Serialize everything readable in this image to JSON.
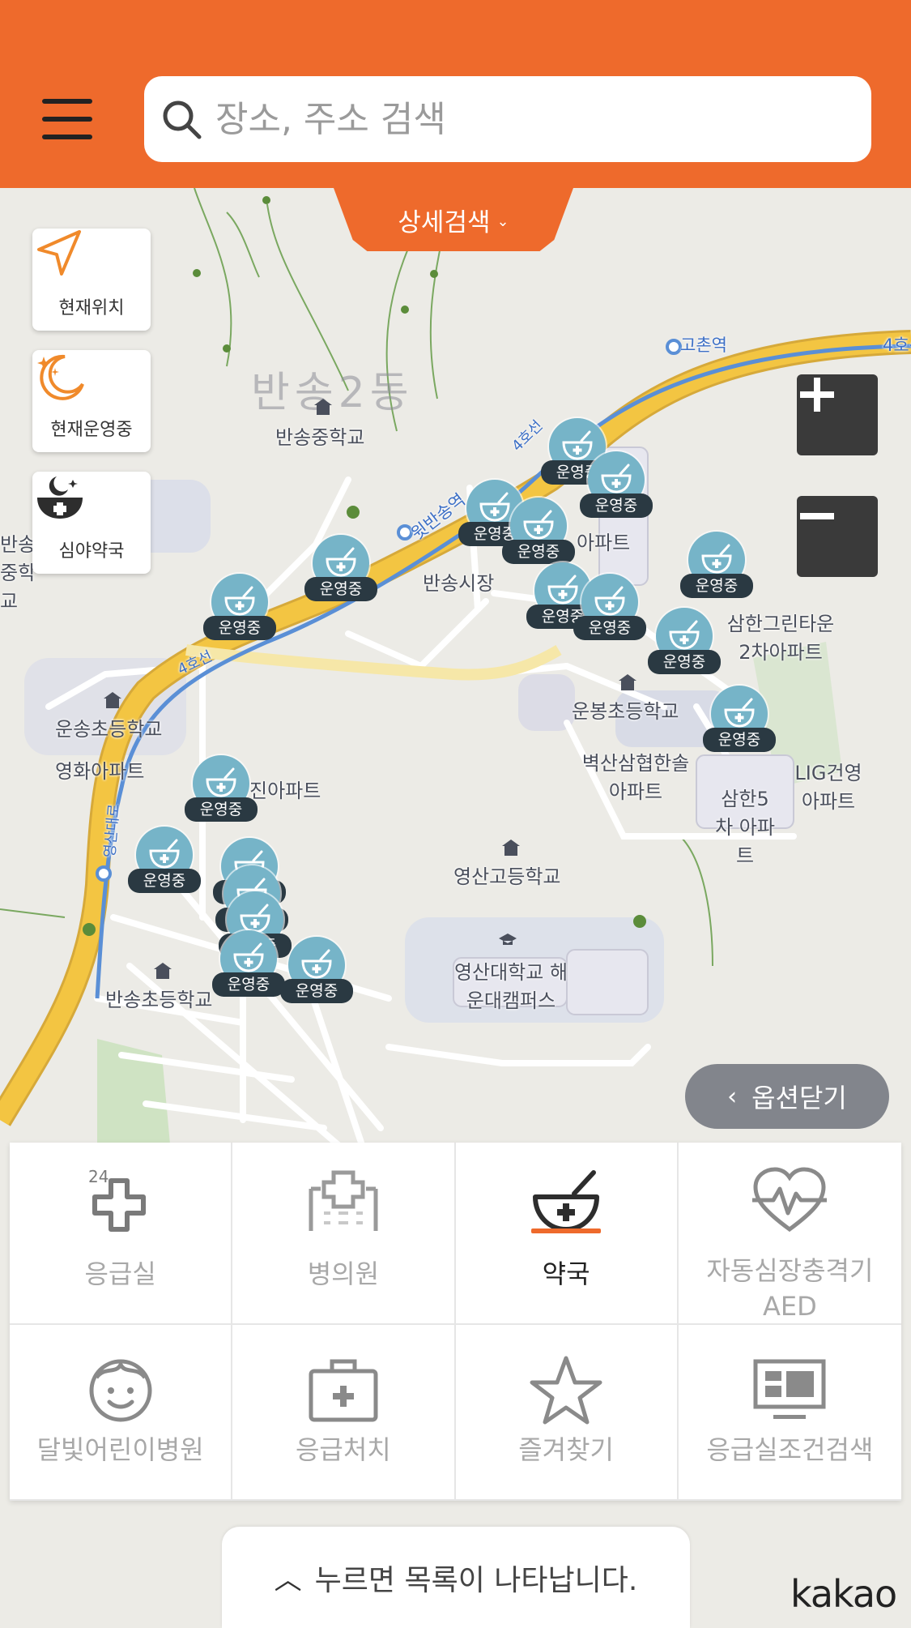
{
  "search": {
    "placeholder": "장소, 주소 검색"
  },
  "detail_search": {
    "label": "상세검색"
  },
  "side_buttons": [
    {
      "label": "현재위치",
      "icon": "location-arrow-icon"
    },
    {
      "label": "현재운영중",
      "icon": "moon-sparkle-icon"
    },
    {
      "label": "심야약국",
      "icon": "night-pharmacy-icon"
    }
  ],
  "zoom": {
    "in": "+",
    "out": "−"
  },
  "map": {
    "district": "반송2동",
    "labels": [
      "반송중학교",
      "반송시장",
      "삼한그린타운 2차아파트",
      "운봉초등학교",
      "벽산삼협한솔 아파트",
      "삼한5차 아파트",
      "LIG건영 아파트",
      "운송초등학교",
      "영화아파트",
      "진아파트",
      "영산고등학교",
      "영산대학교 해운대캠퍼스",
      "반송초등학교",
      "고촌역",
      "윗반송역",
      "4호선",
      "영산대로",
      "아파트",
      "반송 중학교"
    ],
    "marker_label": "운영중"
  },
  "options_close": {
    "label": "옵션닫기"
  },
  "categories": [
    {
      "label": "응급실",
      "icon": "emergency-24-cross-icon",
      "active": false
    },
    {
      "label": "병의원",
      "icon": "hospital-building-icon",
      "active": false
    },
    {
      "label": "약국",
      "icon": "pharmacy-bowl-icon",
      "active": true
    },
    {
      "label": "자동심장충격기\nAED",
      "icon": "heart-pulse-icon",
      "active": false
    },
    {
      "label": "달빛어린이병원",
      "icon": "child-face-icon",
      "active": false
    },
    {
      "label": "응급처치",
      "icon": "first-aid-kit-icon",
      "active": false
    },
    {
      "label": "즐겨찾기",
      "icon": "star-icon",
      "active": false
    },
    {
      "label": "응급실조건검색",
      "icon": "monitor-dashboard-icon",
      "active": false
    }
  ],
  "list_hint": {
    "label": "누르면 목록이 나타납니다."
  },
  "brand": {
    "logo": "kakao"
  },
  "colors": {
    "accent": "#ee6a2c",
    "marker": "#76b4c8",
    "badge": "#2a3942",
    "road": "#f3c542"
  }
}
